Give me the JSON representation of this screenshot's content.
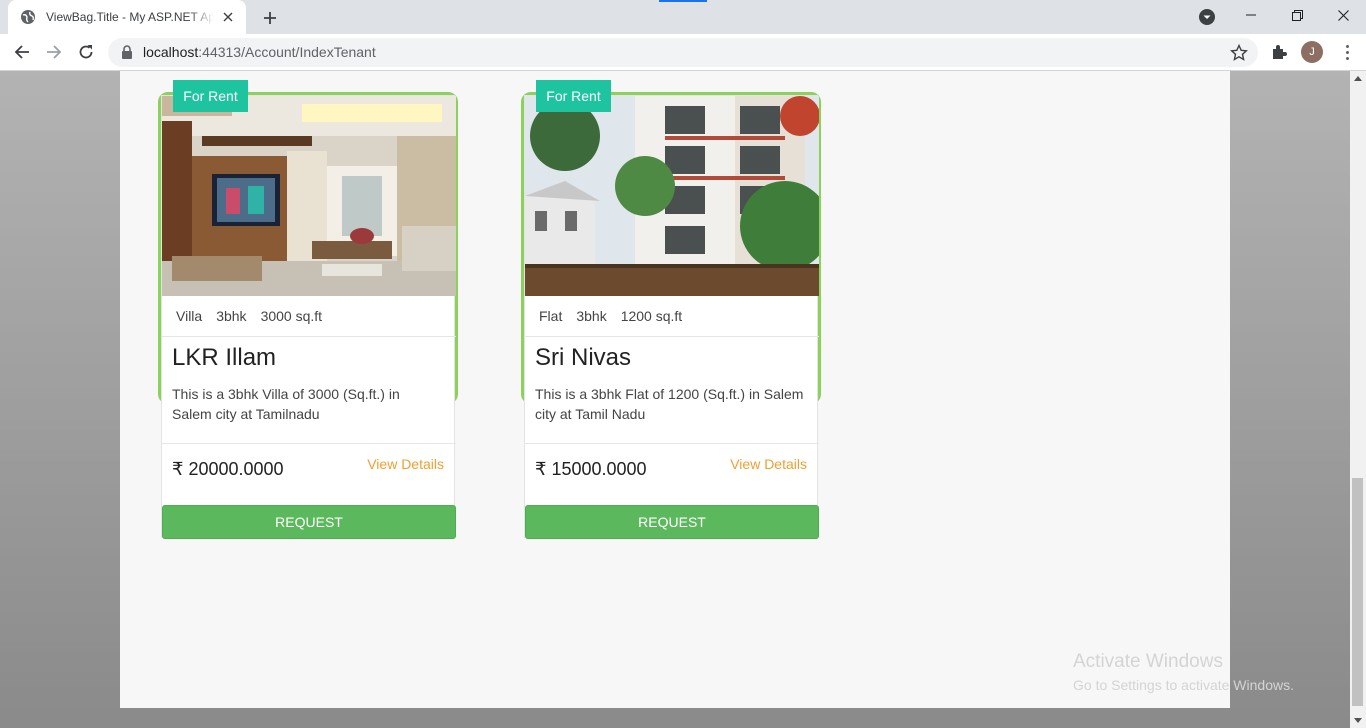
{
  "browser": {
    "tab_title": "ViewBag.Title - My ASP.NET Application",
    "url_host": "localhost",
    "url_rest": ":44313/Account/IndexTenant",
    "avatar_initial": "J"
  },
  "listings": [
    {
      "badge": "For Rent",
      "type": "Villa",
      "bhk": "3bhk",
      "area": "3000 sq.ft",
      "title": "LKR Illam",
      "description": "This is a 3bhk Villa of 3000 (Sq.ft.) in Salem city at Tamilnadu",
      "price": "₹ 20000.0000",
      "details_label": "View Details",
      "request_label": "REQUEST",
      "image_icon": "living-room-photo"
    },
    {
      "badge": "For Rent",
      "type": "Flat",
      "bhk": "3bhk",
      "area": "1200 sq.ft",
      "title": "Sri Nivas",
      "description": "This is a 3bhk Flat of 1200 (Sq.ft.) in Salem city at Tamil Nadu",
      "price": "₹ 15000.0000",
      "details_label": "View Details",
      "request_label": "REQUEST",
      "image_icon": "apartment-building-photo"
    }
  ],
  "watermark": {
    "line1": "Activate Windows",
    "line2": "Go to Settings to activate Windows."
  },
  "colors": {
    "card_border": "#8bd15a",
    "badge": "#1ec4a0",
    "request_button": "#5cb85c",
    "details_link": "#f0a030"
  }
}
